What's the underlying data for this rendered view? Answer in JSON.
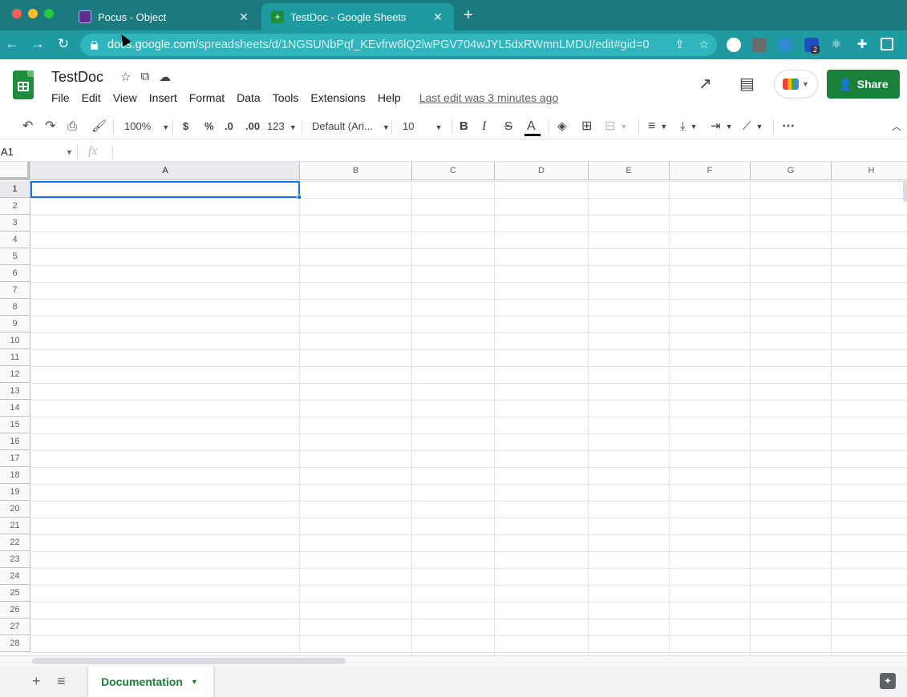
{
  "browser": {
    "tabs": [
      {
        "title": "Pocus - Object",
        "active": false
      },
      {
        "title": "TestDoc - Google Sheets",
        "active": true
      }
    ],
    "new_tab": "+",
    "url_host": "docs.google.com",
    "url_path": "/spreadsheets/d/1NGSUNbPqf_KEvfrw6lQ2lwPGV704wJYL5dxRWmnLMDU/edit#gid=0",
    "extension_badge": "2"
  },
  "sheets": {
    "doc_title": "TestDoc",
    "menu": [
      "File",
      "Edit",
      "View",
      "Insert",
      "Format",
      "Data",
      "Tools",
      "Extensions",
      "Help"
    ],
    "last_edit": "Last edit was 3 minutes ago",
    "share_label": "Share"
  },
  "toolbar": {
    "zoom": "100%",
    "currency": "$",
    "percent": "%",
    "decrease_decimal": ".0",
    "increase_decimal": ".00",
    "format_more": "123",
    "font": "Default (Ari...",
    "font_size": "10",
    "bold": "B",
    "italic": "I",
    "strike": "S",
    "text_color": "A",
    "more": "⋯"
  },
  "formula_bar": {
    "name_box": "A1",
    "fx": "fx"
  },
  "grid": {
    "columns": [
      "A",
      "B",
      "C",
      "D",
      "E",
      "F",
      "G",
      "H"
    ],
    "rows": [
      "1",
      "2",
      "3",
      "4",
      "5",
      "6",
      "7",
      "8",
      "9",
      "10",
      "11",
      "12",
      "13",
      "14",
      "15",
      "16",
      "17",
      "18",
      "19",
      "20",
      "21",
      "22",
      "23",
      "24",
      "25",
      "26",
      "27",
      "28"
    ],
    "selected_cell": "A1"
  },
  "sheet_tabs": {
    "active": "Documentation"
  },
  "colors": {
    "chrome_tab_bg": "#1b7a7f",
    "chrome_addr_bg": "#1e9aa0",
    "sheets_green": "#188038",
    "selection_blue": "#1a73e8"
  }
}
